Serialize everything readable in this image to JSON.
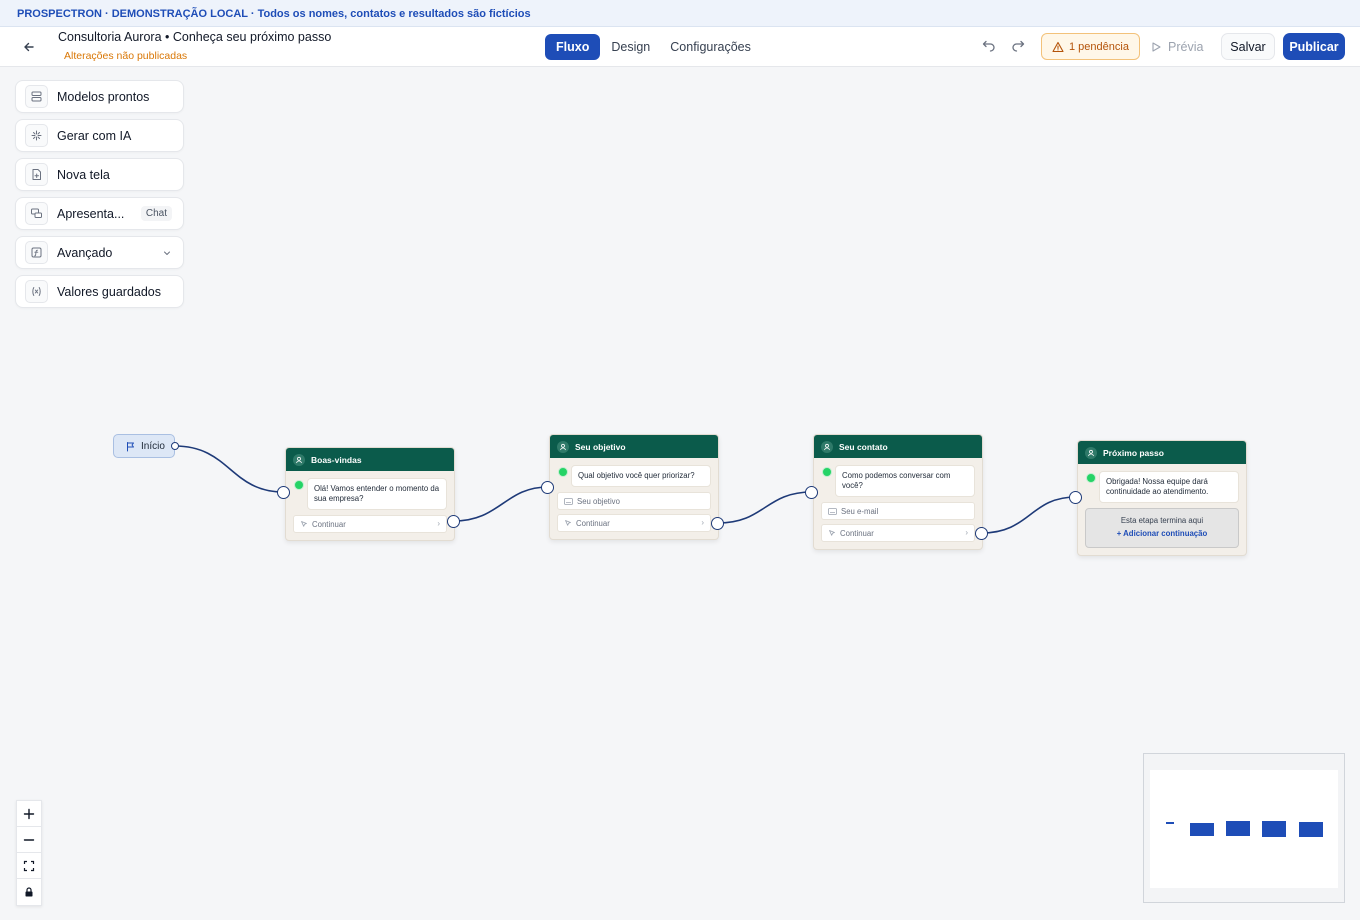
{
  "banner": {
    "text": "PROSPECTRON · DEMONSTRAÇÃO LOCAL · Todos os nomes, contatos e resultados são fictícios"
  },
  "header": {
    "title": "Consultoria Aurora • Conheça seu próximo passo",
    "status": "Alterações não publicadas",
    "tabs": [
      {
        "label": "Fluxo",
        "active": true
      },
      {
        "label": "Design",
        "active": false
      },
      {
        "label": "Configurações",
        "active": false
      }
    ],
    "pending_label": "1 pendência",
    "preview_label": "Prévia",
    "save_label": "Salvar",
    "publish_label": "Publicar"
  },
  "tools": [
    {
      "label": "Modelos prontos",
      "icon": "templates-icon"
    },
    {
      "label": "Gerar com IA",
      "icon": "sparkles-icon"
    },
    {
      "label": "Nova tela",
      "icon": "new-screen-icon"
    },
    {
      "label": "Apresenta...",
      "icon": "chat-bubbles-icon",
      "tag": "Chat"
    },
    {
      "label": "Avançado",
      "icon": "function-icon"
    },
    {
      "label": "Valores guardados",
      "icon": "variable-icon"
    }
  ],
  "flow": {
    "start_label": "Início",
    "nodes": [
      {
        "title": "Boas-vindas",
        "message": "Olá! Vamos entender o momento da sua empresa?",
        "continue_label": "Continuar"
      },
      {
        "title": "Seu objetivo",
        "message": "Qual objetivo você quer priorizar?",
        "field_label": "Seu objetivo",
        "continue_label": "Continuar"
      },
      {
        "title": "Seu contato",
        "message": "Como podemos conversar com você?",
        "field_label": "Seu e-mail",
        "continue_label": "Continuar"
      },
      {
        "title": "Próximo passo",
        "message": "Obrigada! Nossa equipe dará continuidade ao atendimento.",
        "end_text": "Esta etapa termina aqui",
        "end_action": "+ Adicionar continuação"
      }
    ]
  },
  "colors": {
    "accent": "#1e4db7",
    "node_header": "#0b5b4b",
    "warning": "#d97706",
    "whatsapp": "#25d366"
  }
}
